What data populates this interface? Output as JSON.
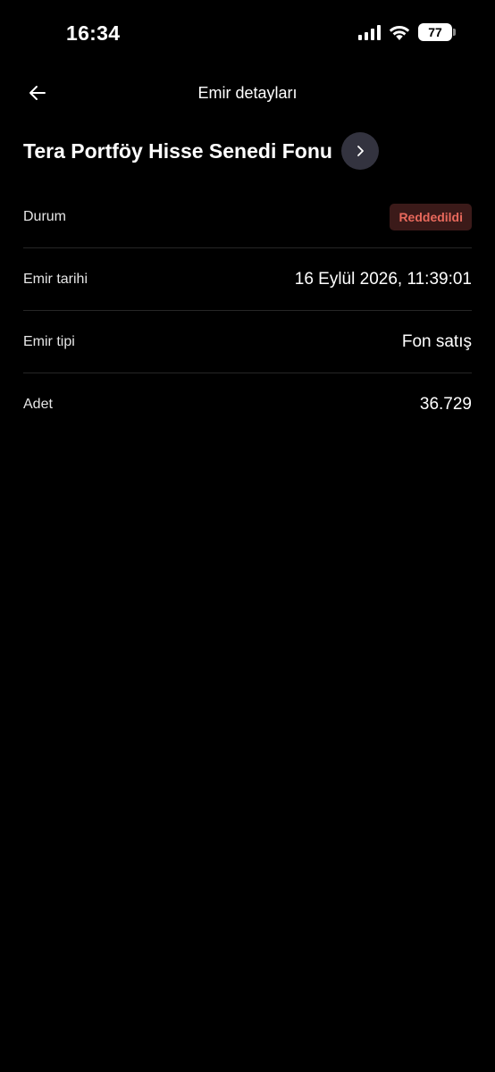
{
  "status_bar": {
    "time": "16:34",
    "battery_level": "77",
    "icons": [
      "signal-icon",
      "wifi-icon",
      "battery-icon"
    ]
  },
  "header": {
    "title": "Emir detayları",
    "back_icon": "arrow-left-icon"
  },
  "fund": {
    "name": "Tera Portföy Hisse Senedi Fonu",
    "link_icon": "chevron-right-icon"
  },
  "details": {
    "status": {
      "label": "Durum",
      "value": "Reddedildi"
    },
    "order_date": {
      "label": "Emir tarihi",
      "value": "16 Eylül 2026, 11:39:01"
    },
    "order_type": {
      "label": "Emir tipi",
      "value": "Fon satış"
    },
    "quantity": {
      "label": "Adet",
      "value": "36.729"
    }
  },
  "colors": {
    "background": "#000000",
    "divider": "#262626",
    "badge_bg": "#3b1a19",
    "badge_text": "#e8695c",
    "circle_button": "#33333f"
  }
}
